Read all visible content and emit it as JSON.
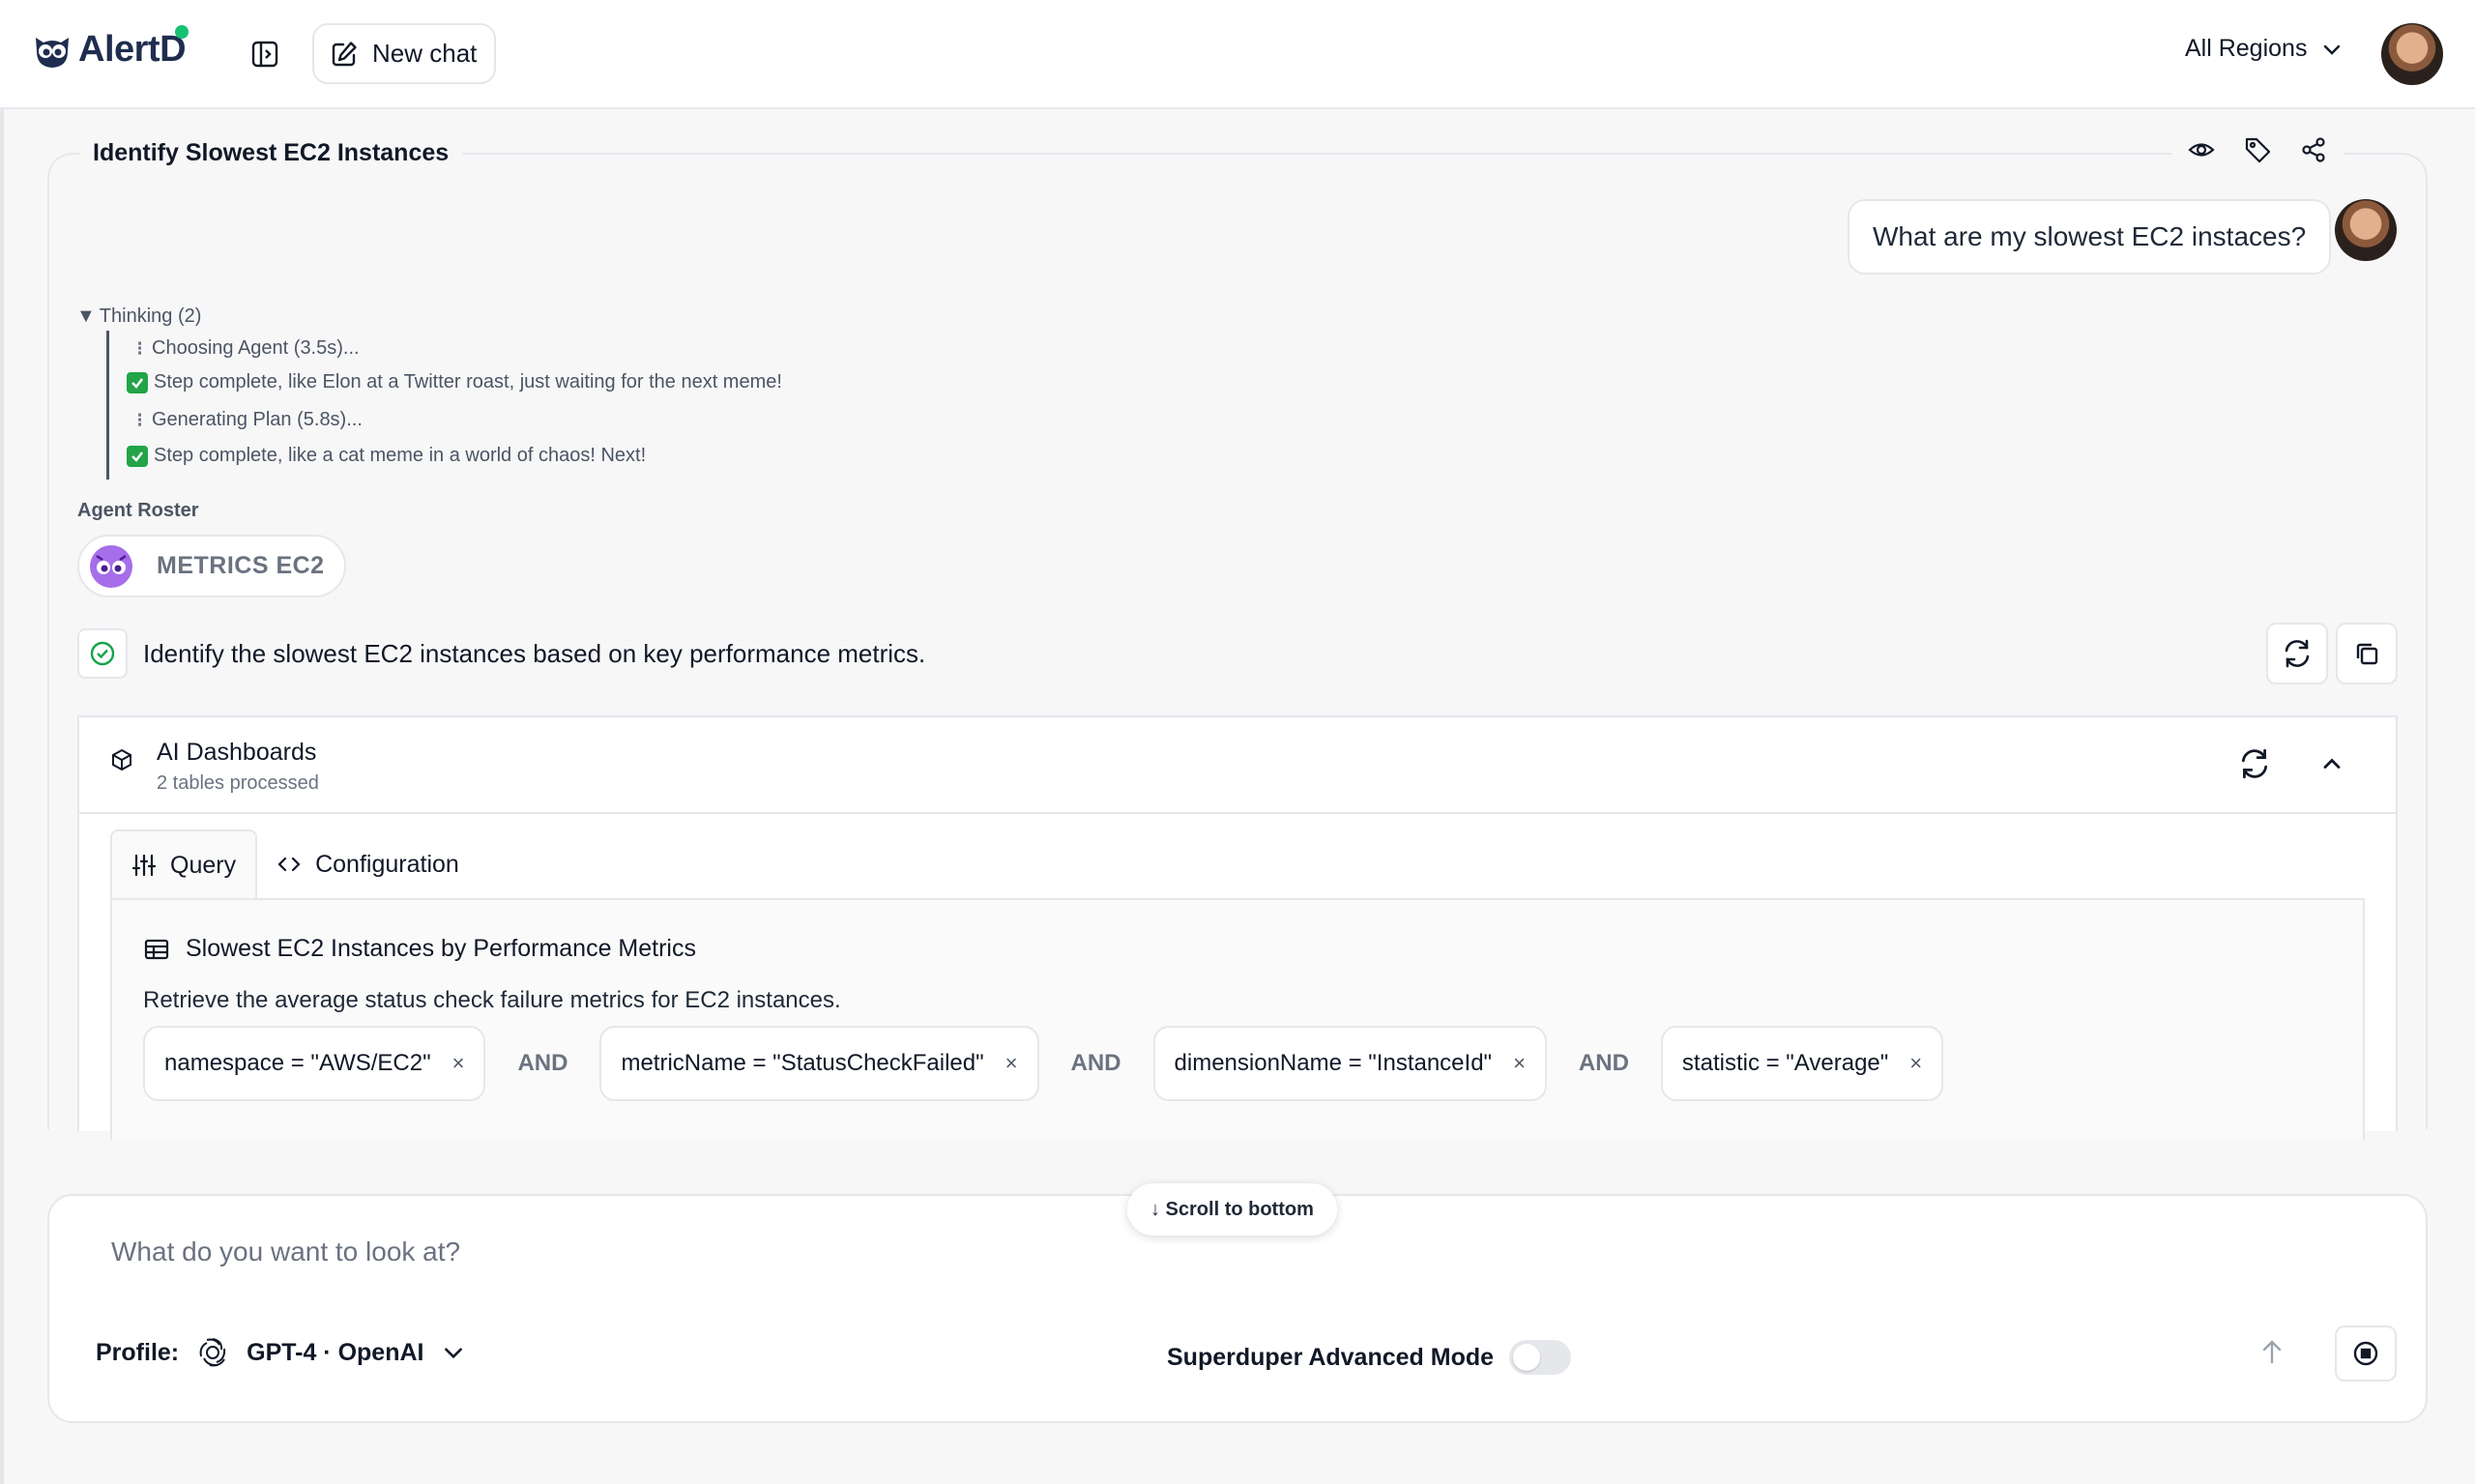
{
  "header": {
    "brand": "AlertD",
    "new_chat_label": "New chat",
    "region_label": "All Regions",
    "status_dot_color": "#16c172"
  },
  "conversation": {
    "title": "Identify Slowest EC2 Instances",
    "title_actions": [
      "eye-icon",
      "tag-icon",
      "share-icon"
    ],
    "user_message": "What are my slowest EC2 instaces?",
    "thinking": {
      "header": "Thinking (2)",
      "steps": [
        {
          "marker": "⁝",
          "text": "Choosing Agent (3.5s)..."
        },
        {
          "marker": "✅",
          "text": "Step complete, like Elon at a Twitter roast, just waiting for the next meme!"
        },
        {
          "marker": "⁝",
          "text": "Generating Plan (5.8s)..."
        },
        {
          "marker": "✅",
          "text": "Step complete, like a cat meme in a world of chaos! Next!"
        }
      ]
    },
    "roster": {
      "label": "Agent Roster",
      "agent_name": "METRICS EC2"
    },
    "task": {
      "text": "Identify the slowest EC2 instances based on key performance metrics."
    },
    "dashboard": {
      "title": "AI Dashboards",
      "subtitle": "2 tables processed",
      "tabs": [
        {
          "label": "Query",
          "active": true
        },
        {
          "label": "Configuration",
          "active": false
        }
      ],
      "query": {
        "title": "Slowest EC2 Instances by Performance Metrics",
        "description": "Retrieve the average status check failure metrics for EC2 instances.",
        "filters": [
          "namespace = \"AWS/EC2\"",
          "metricName = \"StatusCheckFailed\"",
          "dimensionName = \"InstanceId\"",
          "statistic = \"Average\""
        ],
        "join_label": "AND",
        "remove_symbol": "×"
      }
    }
  },
  "composer": {
    "scroll_label": "↓ Scroll to bottom",
    "placeholder": "What do you want to look at?",
    "profile_label": "Profile:",
    "model": "GPT-4 · OpenAI",
    "advanced_label": "Superduper Advanced Mode",
    "advanced_enabled": false
  }
}
